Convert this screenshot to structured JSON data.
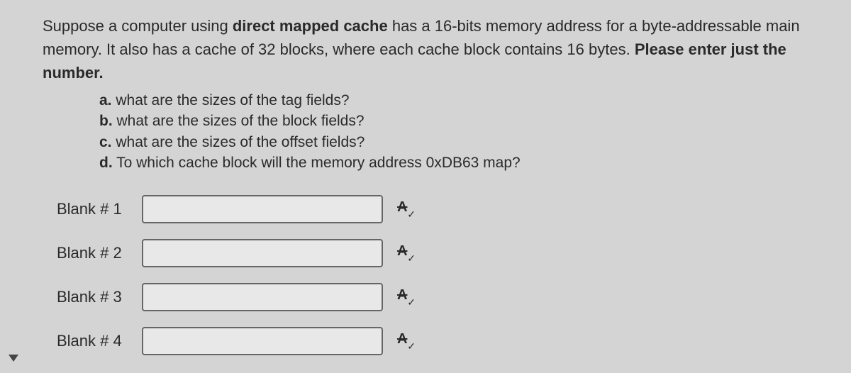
{
  "question": {
    "intro_part1": "Suppose a computer using ",
    "intro_bold1": "direct mapped cache",
    "intro_part2": " has a 16-bits memory address for a byte-addressable main memory.  It also has a cache of 32 blocks, where each cache block contains 16 bytes. ",
    "intro_bold2": "Please enter just the number.",
    "sub": {
      "a_letter": "a.",
      "a_text": " what are the sizes of the tag fields?",
      "b_letter": "b.",
      "b_text": " what are the sizes of the block fields?",
      "c_letter": "c.",
      "c_text": " what are the sizes of the offset fields?",
      "d_letter": "d.",
      "d_text": " To which cache block will the memory address 0xDB63 map?"
    }
  },
  "blanks": {
    "b1_label": "Blank # 1",
    "b1_value": "",
    "b2_label": "Blank # 2",
    "b2_value": "",
    "b3_label": "Blank # 3",
    "b3_value": "",
    "b4_label": "Blank # 4",
    "b4_value": ""
  },
  "icons": {
    "spellcheck": "spellcheck-icon"
  }
}
